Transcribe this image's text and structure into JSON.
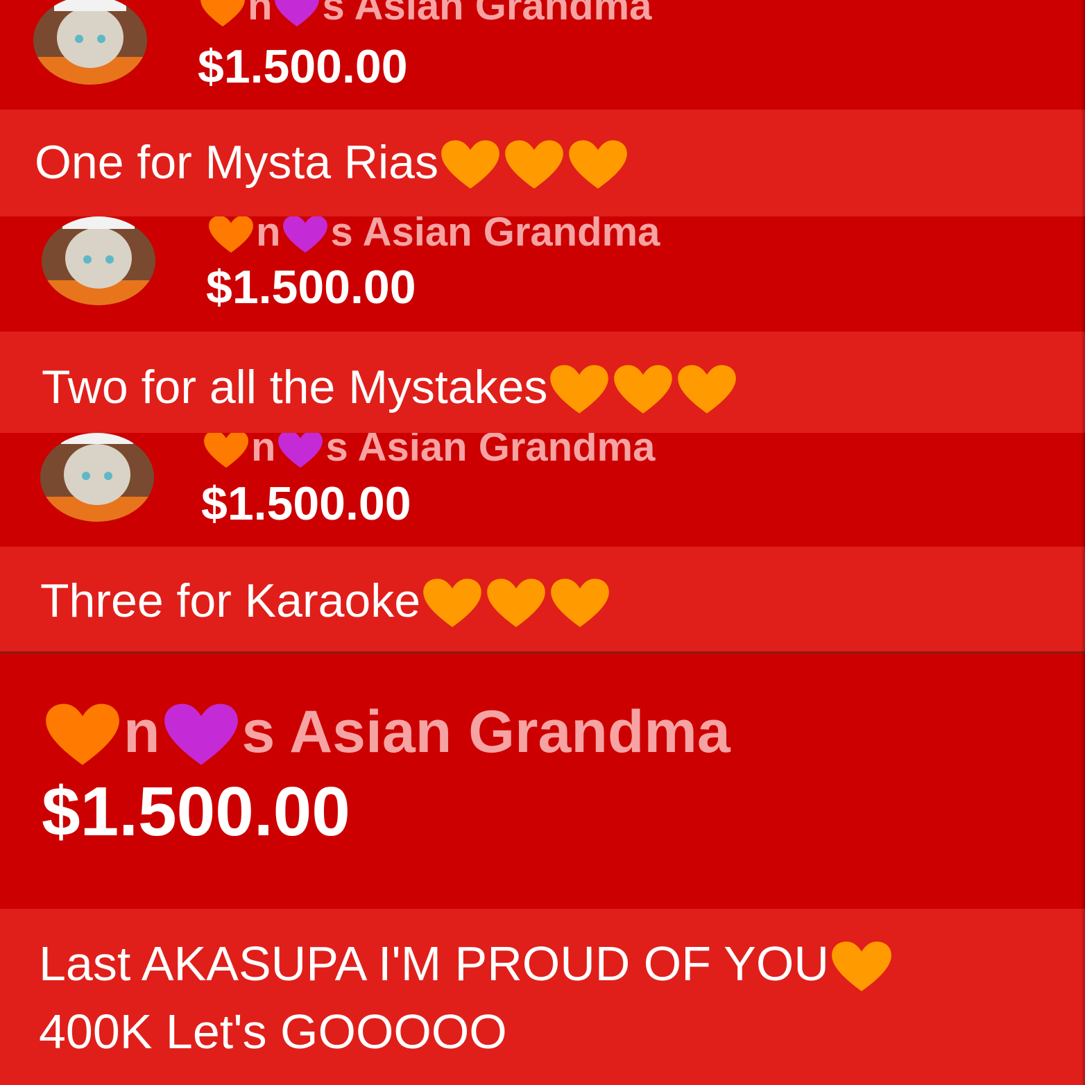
{
  "colors": {
    "header_bg": "#cc0000",
    "message_bg": "#e01f1a",
    "name_text": "#f6a3a3",
    "amount_text": "#ffffff",
    "message_text": "#ffffff",
    "heart_orange": "#ff8a00",
    "heart_purple": "#c42bd6"
  },
  "superchats": [
    {
      "name_part1": "n",
      "name_part2": "s Asian Grandma",
      "name_icons": [
        "orange-heart-icon",
        "purple-heart-icon"
      ],
      "amount": "$1.500.00",
      "message": "One for Mysta Rias",
      "message_icons": [
        "orange-heart-icon",
        "orange-heart-icon",
        "orange-heart-icon"
      ]
    },
    {
      "name_part1": "n",
      "name_part2": "s Asian Grandma",
      "name_icons": [
        "orange-heart-icon",
        "purple-heart-icon"
      ],
      "amount": "$1.500.00",
      "message": "Two for all the Mystakes",
      "message_icons": [
        "orange-heart-icon",
        "orange-heart-icon",
        "orange-heart-icon"
      ]
    },
    {
      "name_part1": "n",
      "name_part2": "s Asian Grandma",
      "name_icons": [
        "orange-heart-icon",
        "purple-heart-icon"
      ],
      "amount": "$1.500.00",
      "message": "Three for Karaoke",
      "message_icons": [
        "orange-heart-icon",
        "orange-heart-icon",
        "orange-heart-icon"
      ]
    },
    {
      "name_part1": "n",
      "name_part2": "s Asian Grandma",
      "name_icons": [
        "orange-heart-icon",
        "purple-heart-icon"
      ],
      "amount": "$1.500.00",
      "message_line1": "Last AKASUPA I'M PROUD OF YOU",
      "message_line2": "400K Let's GOOOOO",
      "message_icons": [
        "orange-heart-icon"
      ]
    }
  ]
}
